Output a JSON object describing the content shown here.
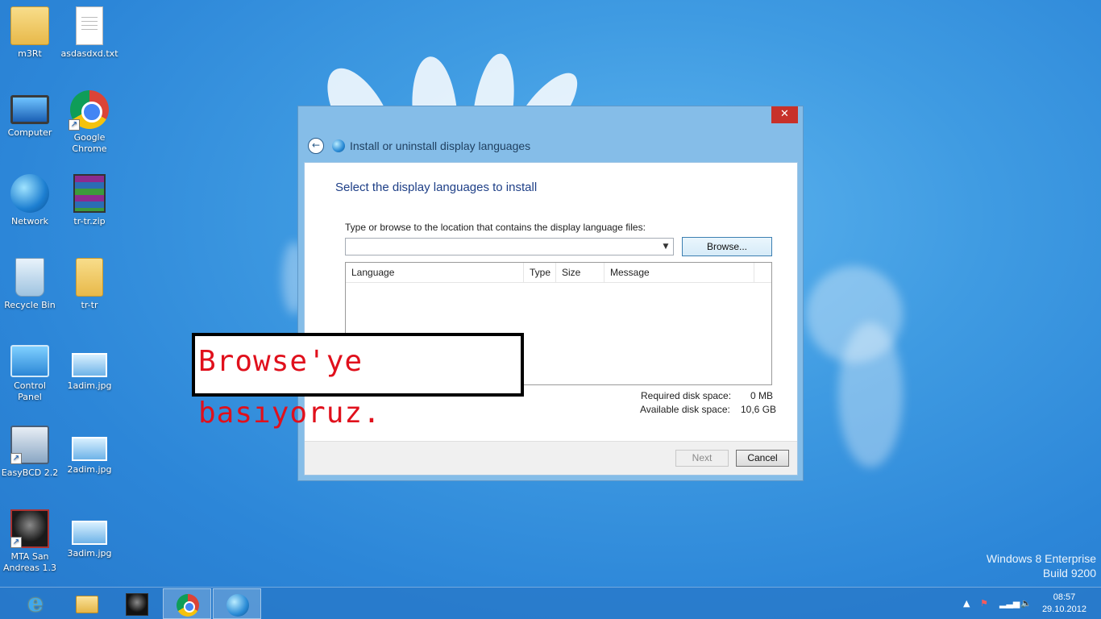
{
  "desktop": {
    "icons": [
      {
        "label": "m3Rt"
      },
      {
        "label": "asdasdxd.txt"
      },
      {
        "label": "Computer"
      },
      {
        "label": "Google Chrome"
      },
      {
        "label": "Network"
      },
      {
        "label": "tr-tr.zip"
      },
      {
        "label": "Recycle Bin"
      },
      {
        "label": "tr-tr"
      },
      {
        "label": "Control Panel"
      },
      {
        "label": "1adim.jpg"
      },
      {
        "label": "EasyBCD 2.2"
      },
      {
        "label": "2adim.jpg"
      },
      {
        "label": "MTA San Andreas 1.3"
      },
      {
        "label": "3adim.jpg"
      }
    ]
  },
  "dialog": {
    "close_symbol": "✕",
    "title": "Install or uninstall display languages",
    "heading": "Select the display languages to install",
    "path_label": "Type or browse to the location that contains the display language files:",
    "path_value": "",
    "browse_label": "Browse...",
    "columns": {
      "language": "Language",
      "type": "Type",
      "size": "Size",
      "message": "Message"
    },
    "required_label": "Required disk space:",
    "required_value": "0 MB",
    "available_label": "Available disk space:",
    "available_value": "10,6 GB",
    "next_label": "Next",
    "cancel_label": "Cancel"
  },
  "annotation": {
    "text": "Browse'ye basıyoruz."
  },
  "watermark": {
    "line1": "Windows 8 Enterprise",
    "line2": "Build 9200"
  },
  "taskbar": {
    "apps": [
      "internet-explorer",
      "file-explorer",
      "mta-san-andreas",
      "google-chrome",
      "language-installer"
    ],
    "clock_time": "08:57",
    "clock_date": "29.10.2012"
  },
  "colors": {
    "accent": "#2c86d8",
    "close": "#c7312a",
    "annotation_text": "#e0101c"
  }
}
